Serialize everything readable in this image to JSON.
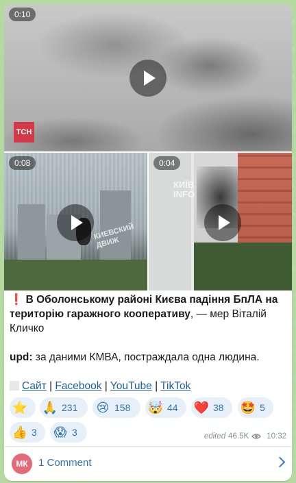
{
  "media": [
    {
      "duration": "0:10",
      "watermark": "ТСН"
    },
    {
      "duration": "0:08",
      "watermark": "КИЕВСКИЙ ДВИЖ"
    },
    {
      "duration": "0:04",
      "watermark": "КИЇВ INFO"
    }
  ],
  "post": {
    "alert": "❗",
    "headline_bold": "В Оболонському районі Києва падіння БпЛА на територію гаражного кооперативу",
    "headline_rest": ", — мер Віталій Кличко",
    "upd_label": "upd:",
    "upd_text": " за даними КМВА, постраждала одна людина.",
    "links": [
      "Сайт",
      "Facebook",
      "YouTube",
      "TikTok"
    ],
    "link_separator": "|"
  },
  "reactions": [
    {
      "icon": "star-icon",
      "glyph": "⭐",
      "count": ""
    },
    {
      "icon": "pray-icon",
      "glyph": "🙏",
      "count": "231"
    },
    {
      "icon": "crying-face-icon",
      "glyph": "😢",
      "count": "158"
    },
    {
      "icon": "exploding-head-icon",
      "glyph": "🤯",
      "count": "44"
    },
    {
      "icon": "heart-icon",
      "glyph": "❤️",
      "count": "38"
    },
    {
      "icon": "star-struck-icon",
      "glyph": "🤩",
      "count": "5"
    },
    {
      "icon": "thumbs-up-icon",
      "glyph": "👍",
      "count": "3"
    },
    {
      "icon": "screaming-face-icon",
      "glyph": "😱",
      "count": "3"
    }
  ],
  "meta": {
    "edited": "edited",
    "views": "46.5K",
    "time": "10:32"
  },
  "comments": {
    "avatar_initials": "МК",
    "label": "1 Comment"
  },
  "colors": {
    "accent": "#2d73b5",
    "reaction_bg": "#e7f0f8",
    "alert": "#e0353b"
  }
}
